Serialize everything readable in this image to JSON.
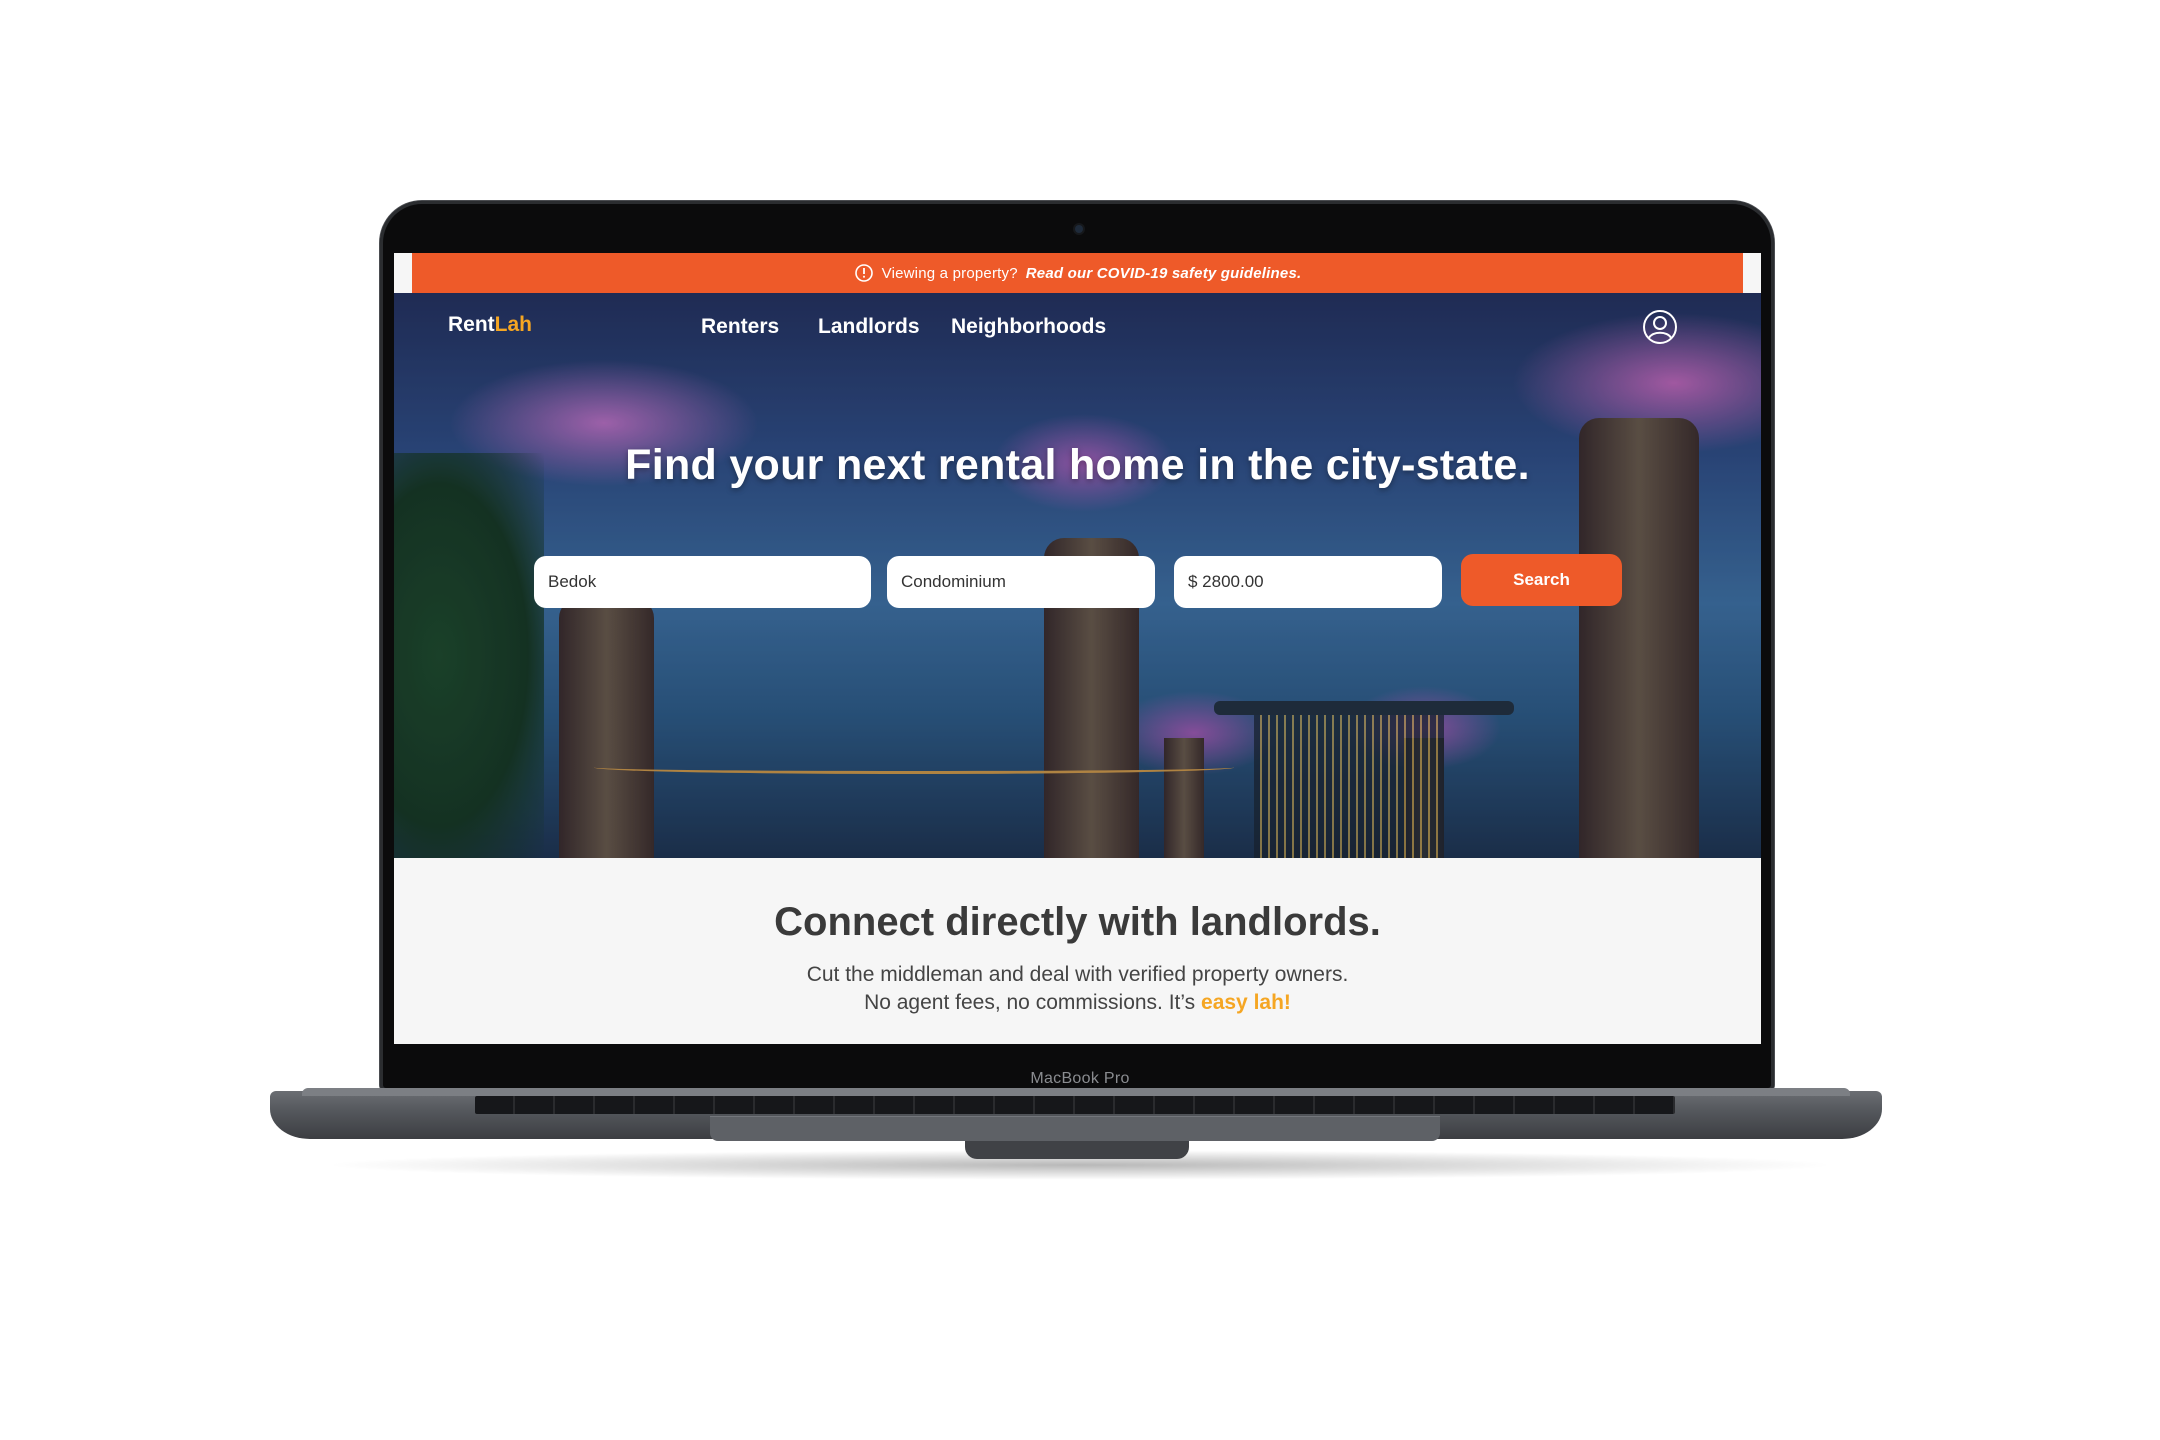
{
  "banner": {
    "text": "Viewing a property?",
    "link": "Read our COVID-19 safety guidelines."
  },
  "brand": {
    "part1": "Rent",
    "part2": "Lah"
  },
  "nav": {
    "renters": "Renters",
    "landlords": "Landlords",
    "neighborhoods": "Neighborhoods"
  },
  "hero": {
    "headline": "Find your next rental home in the city-state.",
    "location_value": "Bedok",
    "type_value": "Condominium",
    "price_value": "$ 2800.00",
    "search_label": "Search"
  },
  "section": {
    "title": "Connect directly with landlords.",
    "line1": "Cut the middleman and deal with verified property owners.",
    "line2_prefix": "No agent fees, no commissions. It’s ",
    "line2_accent": "easy lah!"
  },
  "device": {
    "label": "MacBook Pro"
  },
  "colors": {
    "accent": "#ee5a29",
    "brand_highlight": "#f5a623"
  }
}
